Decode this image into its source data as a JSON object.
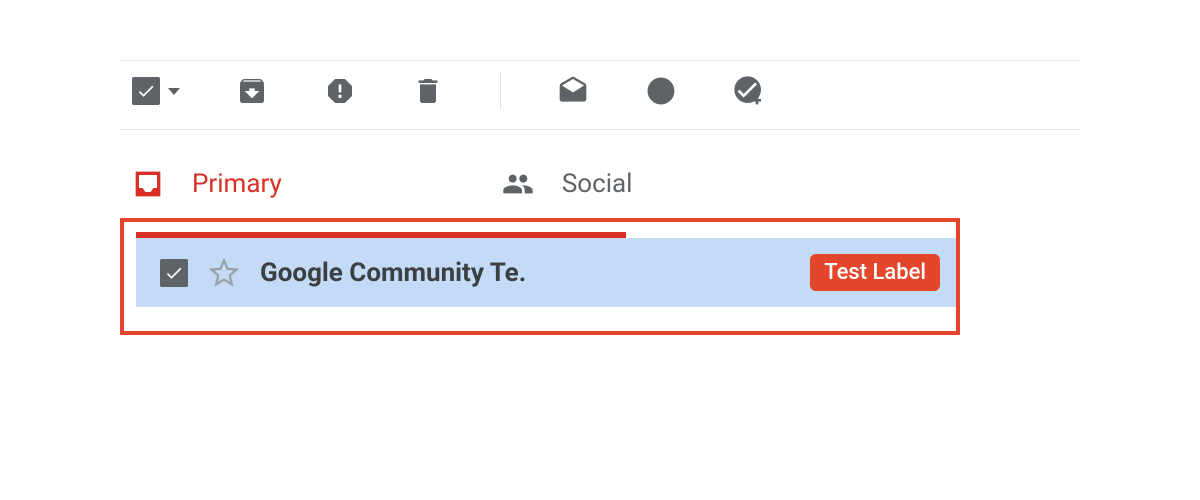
{
  "toolbar": {
    "select_all_checked": true,
    "icons": {
      "archive": "archive-icon",
      "spam": "spam-icon",
      "delete": "delete-icon",
      "mark_read": "mark-read-icon",
      "snooze": "snooze-icon",
      "add_task": "add-task-icon"
    }
  },
  "tabs": {
    "primary": {
      "label": "Primary",
      "active": true
    },
    "social": {
      "label": "Social",
      "active": false
    }
  },
  "email_row": {
    "checked": true,
    "starred": false,
    "sender": "Google Community Te.",
    "label_badge": "Test Label"
  },
  "colors": {
    "accent_red": "#d93025",
    "highlight_border": "#e3462a",
    "selected_bg": "#c3dbf7",
    "icon_gray": "#5f6368"
  }
}
